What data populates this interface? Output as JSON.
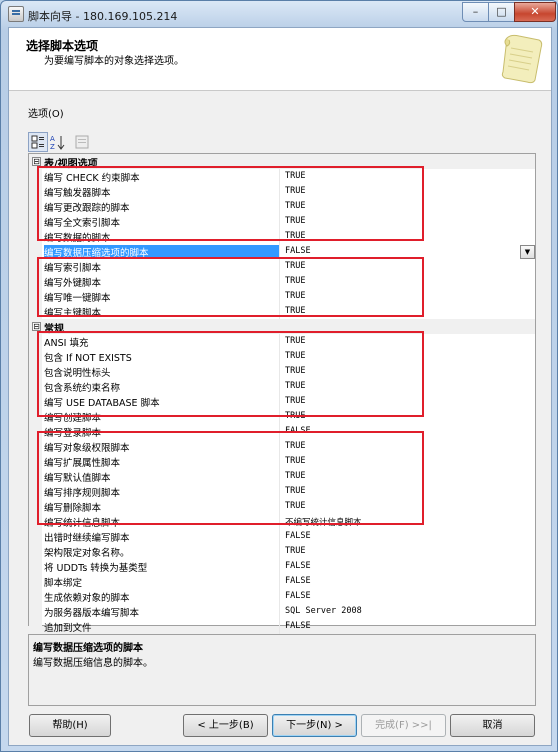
{
  "window": {
    "title": "脚本向导 - 180.169.105.214",
    "minimize_glyph": "–",
    "maximize_glyph": "□",
    "close_glyph": "✕"
  },
  "header": {
    "title": "选择脚本选项",
    "subtitle": "为要编写脚本的对象选择选项。",
    "icon": "scroll-icon"
  },
  "options_label": "选项(O)",
  "toolbar": {
    "categorized_icon": "categorized-icon",
    "alphabetical_icon": "sort-az-icon",
    "property_pages_icon": "property-pages-icon"
  },
  "grid": {
    "categories": [
      {
        "name": "表/视图选项",
        "toggle": "⊟"
      },
      {
        "name": "常规",
        "toggle": "⊟"
      }
    ],
    "table_view": [
      {
        "name": "编写 CHECK 约束脚本",
        "value": "TRUE"
      },
      {
        "name": "编写触发器脚本",
        "value": "TRUE"
      },
      {
        "name": "编写更改跟踪的脚本",
        "value": "TRUE"
      },
      {
        "name": "编写全文索引脚本",
        "value": "TRUE"
      },
      {
        "name": "编写数据的脚本",
        "value": "TRUE"
      },
      {
        "name": "编写数据压缩选项的脚本",
        "value": "FALSE",
        "selected": true
      },
      {
        "name": "编写索引脚本",
        "value": "TRUE"
      },
      {
        "name": "编写外键脚本",
        "value": "TRUE"
      },
      {
        "name": "编写唯一键脚本",
        "value": "TRUE"
      },
      {
        "name": "编写主键脚本",
        "value": "TRUE"
      }
    ],
    "general": [
      {
        "name": "ANSI 填充",
        "value": "TRUE"
      },
      {
        "name": "包含 If NOT EXISTS",
        "value": "TRUE"
      },
      {
        "name": "包含说明性标头",
        "value": "TRUE"
      },
      {
        "name": "包含系统约束名称",
        "value": "TRUE"
      },
      {
        "name": "编写 USE DATABASE 脚本",
        "value": "TRUE"
      },
      {
        "name": "编写创建脚本",
        "value": "TRUE"
      },
      {
        "name": "编写登录脚本",
        "value": "FALSE"
      },
      {
        "name": "编写对象级权限脚本",
        "value": "TRUE"
      },
      {
        "name": "编写扩展属性脚本",
        "value": "TRUE"
      },
      {
        "name": "编写默认值脚本",
        "value": "TRUE"
      },
      {
        "name": "编写排序规则脚本",
        "value": "TRUE"
      },
      {
        "name": "编写删除脚本",
        "value": "TRUE"
      },
      {
        "name": "编写统计信息脚本",
        "value": "不编写统计信息脚本"
      },
      {
        "name": "出错时继续编写脚本",
        "value": "FALSE"
      },
      {
        "name": "架构限定对象名称。",
        "value": "TRUE"
      },
      {
        "name": "将 UDDTs 转换为基类型",
        "value": "FALSE"
      },
      {
        "name": "脚本绑定",
        "value": "FALSE"
      },
      {
        "name": "生成依赖对象的脚本",
        "value": "FALSE"
      },
      {
        "name": "为服务器版本编写脚本",
        "value": "SQL Server 2008"
      },
      {
        "name": "追加到文件",
        "value": "FALSE"
      }
    ],
    "dropdown_glyph": "▼"
  },
  "description": {
    "title": "编写数据压缩选项的脚本",
    "text": "编写数据压缩信息的脚本。"
  },
  "buttons": {
    "help": "帮助(H)",
    "back": "< 上一步(B)",
    "next": "下一步(N) >",
    "finish": "完成(F) >>|",
    "cancel": "取消"
  },
  "colors": {
    "highlight_box": "#e01e2b",
    "selection": "#3399ff"
  }
}
